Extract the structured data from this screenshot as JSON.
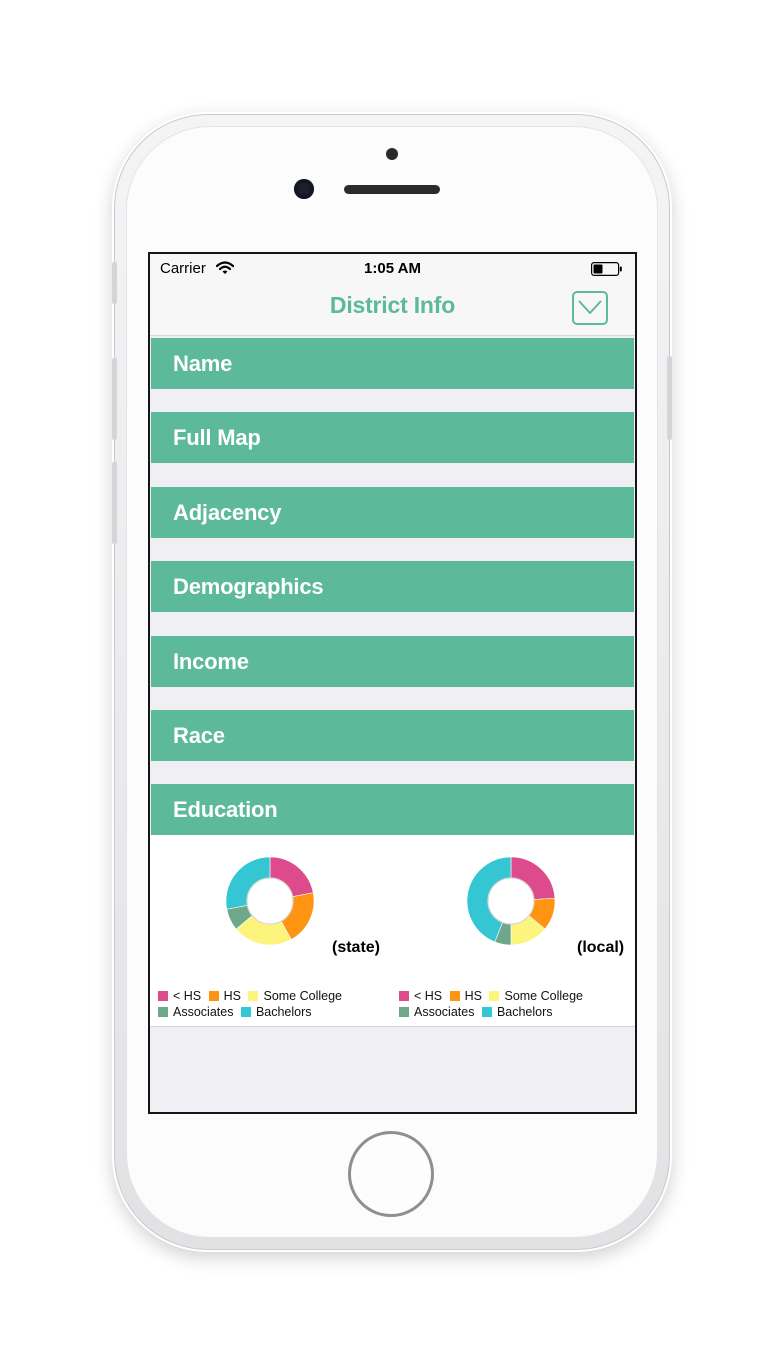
{
  "status_bar": {
    "carrier": "Carrier",
    "time": "1:05 AM"
  },
  "nav": {
    "title": "District Info",
    "action_icon": "chevron-down-icon"
  },
  "sections": [
    {
      "label": "Name"
    },
    {
      "label": "Full Map"
    },
    {
      "label": "Adjacency"
    },
    {
      "label": "Demographics"
    },
    {
      "label": "Income"
    },
    {
      "label": "Race"
    },
    {
      "label": "Education"
    }
  ],
  "colors": {
    "accent": "#5cb99a",
    "less_than_hs": "#de4b8d",
    "hs": "#ff9412",
    "some_college": "#fdf47e",
    "associates": "#6fa78b",
    "bachelors": "#35c6d3"
  },
  "chart_data": [
    {
      "type": "pie",
      "style": "donut",
      "caption": "(state)",
      "categories": [
        "< HS",
        "HS",
        "Some College",
        "Associates",
        "Bachelors"
      ],
      "values": [
        22,
        20,
        22,
        8,
        28
      ]
    },
    {
      "type": "pie",
      "style": "donut",
      "caption": "(local)",
      "categories": [
        "< HS",
        "HS",
        "Some College",
        "Associates",
        "Bachelors"
      ],
      "values": [
        24,
        12,
        14,
        6,
        44
      ]
    }
  ]
}
